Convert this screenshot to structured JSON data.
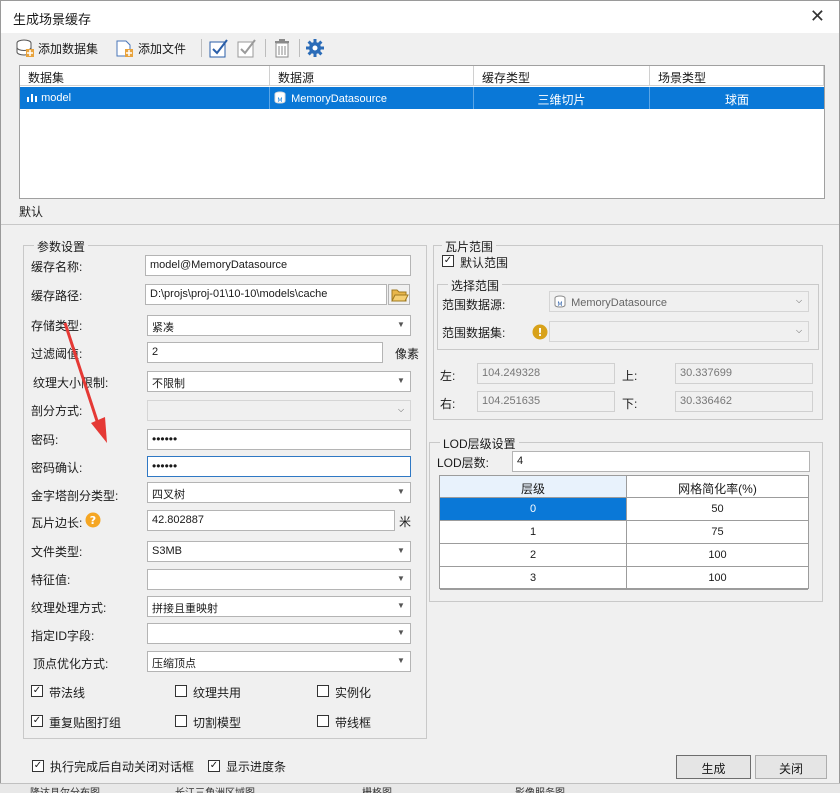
{
  "window": {
    "title": "生成场景缓存"
  },
  "toolbar": {
    "add_dataset": "添加数据集",
    "add_file": "添加文件"
  },
  "grid": {
    "headers": [
      "数据集",
      "数据源",
      "缓存类型",
      "场景类型"
    ],
    "rows": [
      {
        "dataset": "model",
        "datasource": "MemoryDatasource",
        "cache_type": "三维切片",
        "scene_type": "球面"
      }
    ]
  },
  "tabs": {
    "default": "默认"
  },
  "params": {
    "group_title": "参数设置",
    "cache_name_label": "缓存名称:",
    "cache_name": "model@MemoryDatasource",
    "cache_path_label": "缓存路径:",
    "cache_path": "D:\\projs\\proj-01\\10-10\\models\\cache",
    "storage_type_label": "存储类型:",
    "storage_type": "紧凑",
    "filter_label": "过滤阈值:",
    "filter_value": "2",
    "filter_unit": "像素",
    "texture_limit_label": "纹理大小限制:",
    "texture_limit": "不限制",
    "split_mode_label": "剖分方式:",
    "split_mode": "",
    "password_label": "密码:",
    "password": "••••••",
    "password_confirm_label": "密码确认:",
    "password_confirm": "••••••",
    "pyramid_label": "金字塔剖分类型:",
    "pyramid": "四叉树",
    "tile_edge_label": "瓦片边长:",
    "tile_edge": "42.802887",
    "tile_edge_unit": "米",
    "file_type_label": "文件类型:",
    "file_type": "S3MB",
    "feature_label": "特征值:",
    "feature": "",
    "texture_proc_label": "纹理处理方式:",
    "texture_proc": "拼接且重映射",
    "id_field_label": "指定ID字段:",
    "id_field": "",
    "vertex_opt_label": "顶点优化方式:",
    "vertex_opt": "压缩顶点"
  },
  "options": {
    "with_normals": "带法线",
    "with_normals_checked": true,
    "texture_share": "纹理共用",
    "texture_share_checked": false,
    "instancing": "实例化",
    "instancing_checked": false,
    "repeat_texture": "重复贴图打组",
    "repeat_texture_checked": true,
    "cut_model": "切割模型",
    "cut_model_checked": false,
    "wireframe": "带线框",
    "wireframe_checked": false
  },
  "tile_range": {
    "group_title": "瓦片范围",
    "default_range": "默认范围",
    "default_range_checked": true,
    "select_range_title": "选择范围",
    "range_datasource_label": "范围数据源:",
    "range_datasource": "MemoryDatasource",
    "range_dataset_label": "范围数据集:",
    "range_dataset": "",
    "left_label": "左:",
    "left": "104.249328",
    "top_label": "上:",
    "top": "30.337699",
    "right_label": "右:",
    "right": "104.251635",
    "bottom_label": "下:",
    "bottom": "30.336462"
  },
  "lod": {
    "group_title": "LOD层级设置",
    "levels_label": "LOD层数:",
    "levels": "4",
    "headers": [
      "层级",
      "网格简化率(%)"
    ],
    "rows": [
      {
        "level": "0",
        "rate": "50"
      },
      {
        "level": "1",
        "rate": "75"
      },
      {
        "level": "2",
        "rate": "100"
      },
      {
        "level": "3",
        "rate": "100"
      }
    ]
  },
  "footer": {
    "auto_close": "执行完成后自动关闭对话框",
    "auto_close_checked": true,
    "show_progress": "显示进度条",
    "show_progress_checked": true,
    "generate": "生成",
    "close": "关闭"
  },
  "background_strip": [
    "隆达县尔分布图",
    "长江三角洲区域图",
    "栅格图",
    "影像服务图"
  ],
  "colors": {
    "selection": "#0a78d7",
    "arrow": "#e53935",
    "help": "#f5a623"
  }
}
